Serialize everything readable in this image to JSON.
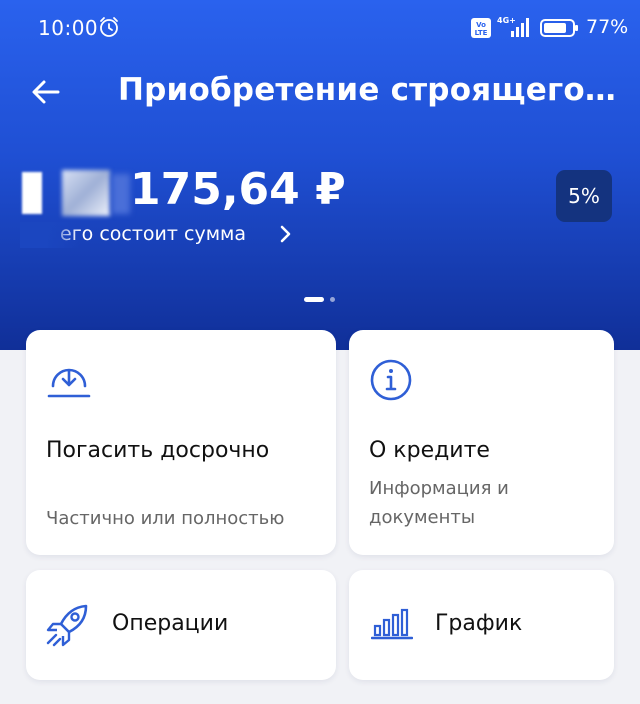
{
  "status": {
    "time": "10:00",
    "battery": "77%",
    "network": "4G+",
    "volte": "Vo LTE"
  },
  "header": {
    "title": "Приобретение строящегося ж..."
  },
  "balance": {
    "amount": "175,64 ₽",
    "rate": "5%",
    "composition_link": "его состоит сумма",
    "pager": {
      "pages": 2,
      "active": 1
    }
  },
  "cards": {
    "early": {
      "title": "Погасить досрочно",
      "subtitle": "Частично или полностью"
    },
    "info": {
      "title": "О кредите",
      "subtitle": "Информация и документы"
    },
    "ops": {
      "title": "Операции"
    },
    "schedule": {
      "title": "График"
    }
  },
  "colors": {
    "accent": "#2a62ee",
    "hero_dark": "#102f98",
    "icon": "#2f5fd6",
    "badge": "#14337f"
  },
  "icons": {
    "back": "arrow-left-icon",
    "alarm": "alarm-icon",
    "chevron": "chevron-right-icon",
    "early": "download-circle-icon",
    "info": "info-icon",
    "ops": "rocket-icon",
    "schedule": "bar-chart-icon"
  }
}
